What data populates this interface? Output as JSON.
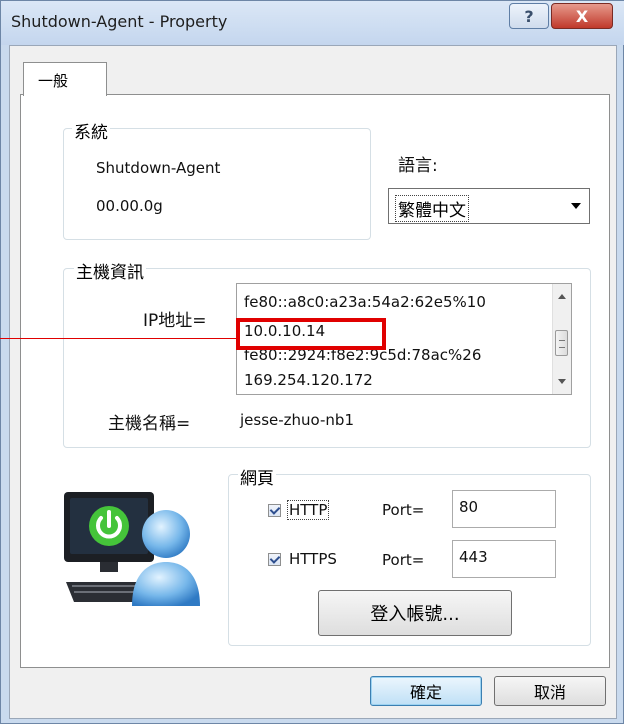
{
  "window": {
    "title": "Shutdown-Agent - Property",
    "help_glyph": "?",
    "close_glyph": "X"
  },
  "tabs": [
    {
      "label": "一般"
    }
  ],
  "system": {
    "group_label": "系統",
    "app_name": "Shutdown-Agent",
    "version": "00.00.0g"
  },
  "language": {
    "label": "語言:",
    "selected": "繁體中文"
  },
  "host": {
    "group_label": "主機資訊",
    "ip_label": "IP地址=",
    "ip_list": [
      "fe80::a8c0:a23a:54a2:62e5%10",
      "10.0.10.14",
      "fe80::2924:f8e2:9c5d:78ac%26",
      "169.254.120.172"
    ],
    "hostname_label": "主機名稱=",
    "hostname": "jesse-zhuo-nb1"
  },
  "web": {
    "group_label": "網頁",
    "http_label": "HTTP",
    "http_checked": true,
    "https_label": "HTTPS",
    "https_checked": true,
    "port_label": "Port=",
    "http_port": "80",
    "https_port": "443",
    "login_button": "登入帳號..."
  },
  "footer": {
    "ok": "確定",
    "cancel": "取消"
  },
  "icons": {
    "computer": "computer-power-icon",
    "user": "user-icon"
  },
  "colors": {
    "highlight": "#e00000",
    "title_bar": "#c4d6ee",
    "close_button": "#c0392b"
  }
}
